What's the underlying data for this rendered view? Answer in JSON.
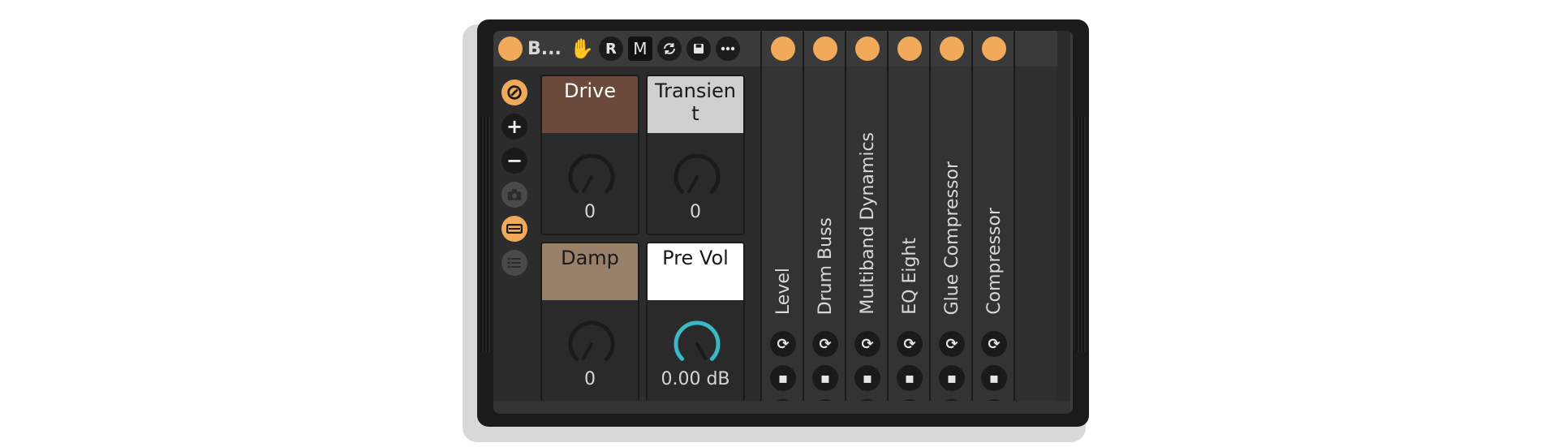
{
  "device": {
    "title": "B...",
    "header_buttons": [
      {
        "name": "hand-icon"
      },
      {
        "label": "R"
      },
      {
        "label": "M"
      },
      {
        "name": "refresh-icon"
      },
      {
        "name": "save-icon"
      },
      {
        "name": "more-icon"
      }
    ],
    "tools": [
      {
        "name": "map-icon"
      },
      {
        "label": "+"
      },
      {
        "label": "−"
      },
      {
        "name": "camera-icon"
      },
      {
        "name": "collapse-icon"
      },
      {
        "name": "list-icon"
      }
    ]
  },
  "macros": [
    {
      "label": "Drive",
      "value": "0",
      "color": "#6b4a3c",
      "text_color": "#ffffff"
    },
    {
      "label": "Transient",
      "value": "0",
      "color": "#cfcfcf",
      "text_color": "#1a1a1a"
    },
    {
      "label": "Damp",
      "value": "0",
      "color": "#98806a",
      "text_color": "#1a1a1a"
    },
    {
      "label": "Pre Vol",
      "value": "0.00 dB",
      "color": "#ffffff",
      "text_color": "#1a1a1a"
    }
  ],
  "chains": [
    {
      "name": "Level"
    },
    {
      "name": "Drum Buss"
    },
    {
      "name": "Multiband Dynamics"
    },
    {
      "name": "EQ Eight"
    },
    {
      "name": "Glue Compressor"
    },
    {
      "name": "Compressor"
    }
  ],
  "colors": {
    "accent_orange": "#f0aa5a",
    "knob_blue": "#3bb8c6",
    "hand_blue": "#5a6cf2"
  }
}
